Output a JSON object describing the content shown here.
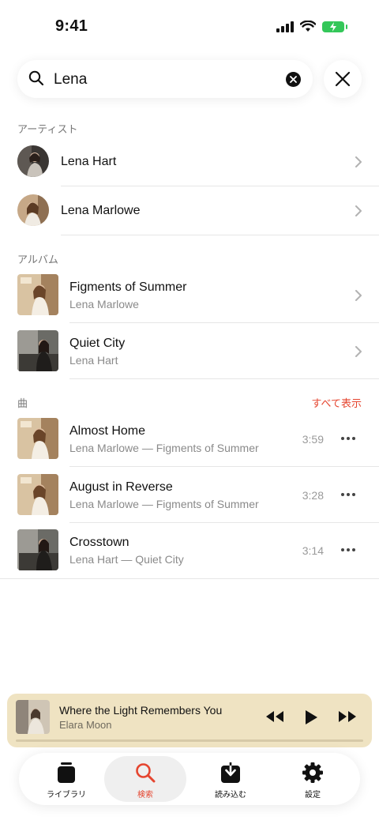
{
  "status_bar": {
    "time": "9:41"
  },
  "search": {
    "query": "Lena",
    "placeholder": ""
  },
  "sections": {
    "artists_title": "アーティスト",
    "albums_title": "アルバム",
    "songs_title": "曲",
    "songs_see_all": "すべて表示"
  },
  "artists": [
    {
      "name": "Lena Hart"
    },
    {
      "name": "Lena Marlowe"
    }
  ],
  "albums": [
    {
      "title": "Figments of Summer",
      "artist": "Lena Marlowe"
    },
    {
      "title": "Quiet City",
      "artist": "Lena Hart"
    }
  ],
  "songs": [
    {
      "title": "Almost Home",
      "subtitle": "Lena Marlowe — Figments of Summer",
      "duration": "3:59"
    },
    {
      "title": "August in Reverse",
      "subtitle": "Lena Marlowe — Figments of Summer",
      "duration": "3:28"
    },
    {
      "title": "Crosstown",
      "subtitle": "Lena Hart — Quiet City",
      "duration": "3:14"
    }
  ],
  "now_playing": {
    "title": "Where the Light Remembers You",
    "artist": "Elara Moon",
    "progress": 0.0
  },
  "tabs": [
    {
      "label": "ライブラリ",
      "icon": "library-icon"
    },
    {
      "label": "検索",
      "icon": "search-icon"
    },
    {
      "label": "読み込む",
      "icon": "download-icon"
    },
    {
      "label": "設定",
      "icon": "gear-icon"
    }
  ],
  "colors": {
    "accent": "#e5452f",
    "player_bg": "#efe3c2",
    "battery": "#34c759"
  }
}
